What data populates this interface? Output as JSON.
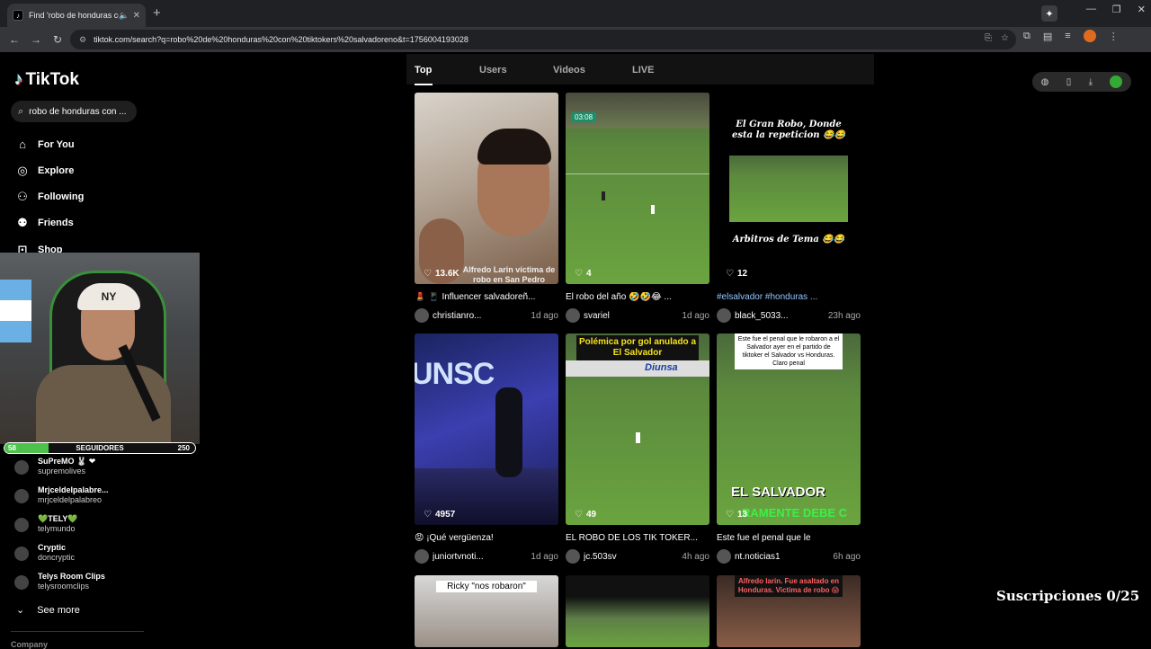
{
  "browser": {
    "tab_title": "Find 'robo de honduras con",
    "url": "tiktok.com/search?q=robo%20de%20honduras%20con%20tiktokers%20salvadoreno&t=1756004193028"
  },
  "sidebar": {
    "logo": "TikTok",
    "search_value": "robo de honduras con ...",
    "nav": [
      {
        "label": "For You",
        "icon": "home-icon"
      },
      {
        "label": "Explore",
        "icon": "compass-icon"
      },
      {
        "label": "Following",
        "icon": "user-icon"
      },
      {
        "label": "Friends",
        "icon": "users-icon"
      },
      {
        "label": "Shop",
        "icon": "shop-icon"
      }
    ],
    "followers_bar": {
      "left": "58",
      "label": "SEGUIDORES",
      "right": "250",
      "progress": 0.23
    },
    "accounts": [
      {
        "name": "SuPreMO 🐰 ❤",
        "handle": "supremolives"
      },
      {
        "name": "Mrjceldelpalabre...",
        "handle": "mrjceldelpalabreo"
      },
      {
        "name": "💚TELY💚",
        "handle": "telymundo"
      },
      {
        "name": "Cryptic",
        "handle": "doncryptic"
      },
      {
        "name": "Telys Room Clips",
        "handle": "telysroomclips"
      }
    ],
    "see_more": "See more",
    "company": "Company"
  },
  "tabs": [
    {
      "label": "Top",
      "active": true
    },
    {
      "label": "Users",
      "active": false
    },
    {
      "label": "Videos",
      "active": false
    },
    {
      "label": "LIVE",
      "active": false
    }
  ],
  "videos": [
    {
      "likes": "13.6K",
      "desc": "💄 📱 Influencer salvadoreñ...",
      "user": "christianro...",
      "time": "1d ago",
      "overlay": "Alfredo Larin víctima de robo en San Pedro"
    },
    {
      "likes": "4",
      "desc": "El robo del año 🤣🤣😂 ...",
      "user": "svariel",
      "time": "1d ago",
      "overlay": "03:08"
    },
    {
      "likes": "12",
      "desc": "#elsalvador #honduras ...",
      "user": "black_5033...",
      "time": "23h ago",
      "overlay_top": "El Gran Robo, Donde esta la repeticion 😂😂",
      "overlay_bottom": "Arbitros de Tema 😂😂"
    },
    {
      "likes": "4957",
      "desc": "😡 ¡Qué vergüenza!",
      "user": "juniortvnoti...",
      "time": "1d ago",
      "overlay": "UNSC"
    },
    {
      "likes": "49",
      "desc": "EL ROBO DE LOS TIK TOKER...",
      "user": "jc.503sv",
      "time": "4h ago",
      "overlay": "Polémica por gol anulado a El Salvador",
      "brand": "Diunsa"
    },
    {
      "likes": "13",
      "desc": "Este fue el penal que le",
      "user": "nt.noticias1",
      "time": "6h ago",
      "overlay_top": "Este fue el penal que le robaron a el Salvador ayer en el partido de tiktoker el Salvador vs Honduras. Claro penal",
      "overlay_bottom": "EL SALVADOR",
      "overlay_bottom2": "RAMENTE DEBE C"
    }
  ],
  "partial_videos": [
    {
      "overlay": "Ricky \"nos robaron\""
    },
    {
      "overlay": ""
    },
    {
      "overlay": "Alfredo larin. Fue asaltado en Honduras. Victima de robo 😱"
    }
  ],
  "stream_overlay": {
    "subs": "Suscripciones 0/25"
  }
}
